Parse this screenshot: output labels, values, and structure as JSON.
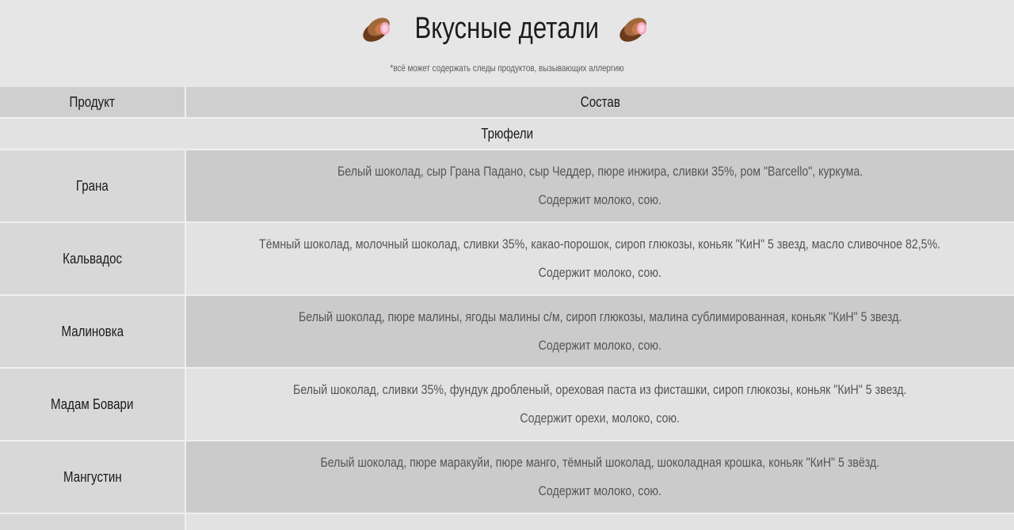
{
  "header": {
    "title": "Вкусные детали",
    "subtitle": "*всё может содержать следы продуктов, вызывающих аллергию",
    "icon": "chocolate-candy-icon"
  },
  "table": {
    "columns": [
      "Продукт",
      "Состав"
    ],
    "section": "Трюфели",
    "rows": [
      {
        "name": "Грана",
        "composition": "Белый шоколад, сыр Грана Падано, сыр Чеддер, пюре инжира, сливки 35%, ром \"Barcello\", куркума.",
        "allergens": "Содержит молоко, сою."
      },
      {
        "name": "Кальвадос",
        "composition": "Тёмный шоколад, молочный шоколад, сливки 35%, какао-порошок, сироп глюкозы, коньяк \"КиН\" 5 звезд, масло сливочное 82,5%.",
        "allergens": "Содержит молоко, сою."
      },
      {
        "name": "Малиновка",
        "composition": "Белый шоколад, пюре малины, ягоды малины с/м, сироп глюкозы, малина сублимированная, коньяк \"КиН\" 5 звезд.",
        "allergens": "Содержит молоко, сою."
      },
      {
        "name": "Мадам Бовари",
        "composition": "Белый шоколад, сливки 35%, фундук дробленый, ореховая паста из фисташки, сироп глюкозы, коньяк \"КиН\" 5 звезд.",
        "allergens": "Содержит орехи, молоко, сою."
      },
      {
        "name": "Мангустин",
        "composition": "Белый шоколад, пюре маракуйи, пюре манго, тёмный шоколад, шоколадная крошка, коньяк \"КиН\" 5 звёзд.",
        "allergens": "Содержит молоко, сою."
      }
    ]
  }
}
